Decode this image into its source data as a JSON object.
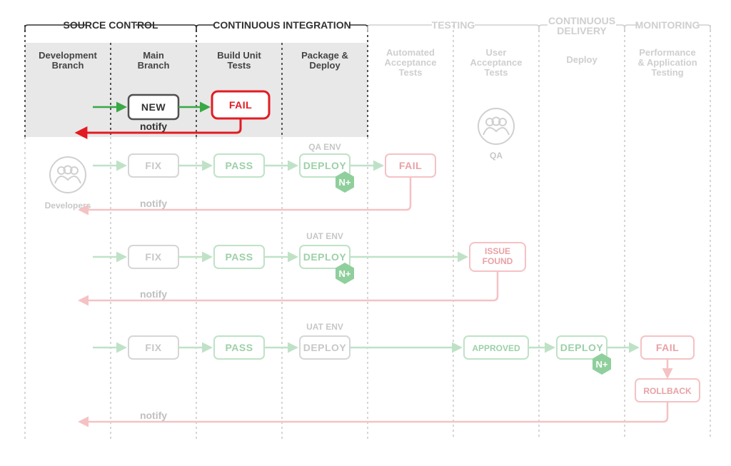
{
  "sections": {
    "source_control": "SOURCE CONTROL",
    "ci": "CONTINUOUS INTEGRATION",
    "testing": "TESTING",
    "cd": "CONTINUOUS\nDELIVERY",
    "monitoring": "MONITORING"
  },
  "columns": {
    "dev_branch": "Development\nBranch",
    "main_branch": "Main\nBranch",
    "build_tests": "Build Unit\nTests",
    "package_deploy": "Package &\nDeploy",
    "auto_accept": "Automated\nAcceptance\nTests",
    "user_accept": "User\nAcceptance\nTests",
    "deploy": "Deploy",
    "perf_testing": "Performance\n& Application\nTesting"
  },
  "people": {
    "developers": "Developers",
    "qa": "QA"
  },
  "envs": {
    "qa": "QA ENV",
    "uat": "UAT ENV"
  },
  "boxes": {
    "new": "NEW",
    "fail": "FAIL",
    "fix": "FIX",
    "pass": "PASS",
    "deploy": "DEPLOY",
    "issue_found": "ISSUE\nFOUND",
    "approved": "APPROVED",
    "rollback": "ROLLBACK"
  },
  "labels": {
    "notify": "notify",
    "nplus": "N+"
  },
  "colors": {
    "highlight_bg": "#e8e8e8",
    "green": "#39a845",
    "green_fade": "#bfe2c7",
    "red": "#e31b23",
    "red_fade": "#f5c2c4",
    "grey_box": "#505050",
    "grey_fade": "#d0d0d0"
  }
}
